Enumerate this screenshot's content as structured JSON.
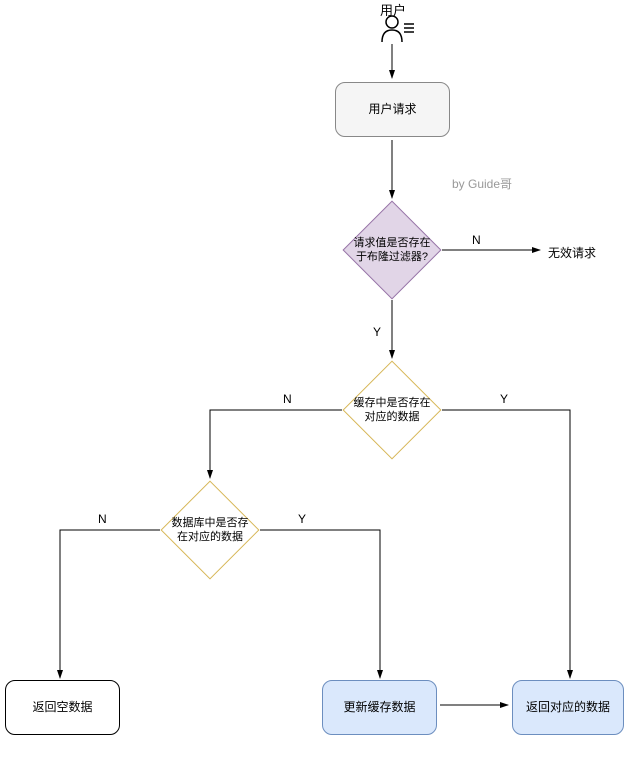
{
  "actor": {
    "label": "用户"
  },
  "nodes": {
    "request": "用户请求",
    "bloom_filter": "请求值是否存在于布隆过滤器?",
    "invalid": "无效请求",
    "cache_check": "缓存中是否存在对应的数据",
    "db_check": "数据库中是否存在对应的数据",
    "return_empty": "返回空数据",
    "update_cache": "更新缓存数据",
    "return_data": "返回对应的数据"
  },
  "labels": {
    "yes": "Y",
    "no": "N"
  },
  "credit": "by Guide哥",
  "chart_data": {
    "type": "flowchart",
    "title": "",
    "nodes": [
      {
        "id": "user",
        "type": "actor",
        "label": "用户"
      },
      {
        "id": "request",
        "type": "process",
        "label": "用户请求"
      },
      {
        "id": "bloom",
        "type": "decision",
        "label": "请求值是否存在于布隆过滤器?"
      },
      {
        "id": "invalid",
        "type": "terminal",
        "label": "无效请求"
      },
      {
        "id": "cache",
        "type": "decision",
        "label": "缓存中是否存在对应的数据"
      },
      {
        "id": "db",
        "type": "decision",
        "label": "数据库中是否存在对应的数据"
      },
      {
        "id": "empty",
        "type": "process",
        "label": "返回空数据"
      },
      {
        "id": "update",
        "type": "process",
        "label": "更新缓存数据"
      },
      {
        "id": "return",
        "type": "process",
        "label": "返回对应的数据"
      }
    ],
    "edges": [
      {
        "from": "user",
        "to": "request",
        "label": ""
      },
      {
        "from": "request",
        "to": "bloom",
        "label": ""
      },
      {
        "from": "bloom",
        "to": "invalid",
        "label": "N"
      },
      {
        "from": "bloom",
        "to": "cache",
        "label": "Y"
      },
      {
        "from": "cache",
        "to": "db",
        "label": "N"
      },
      {
        "from": "cache",
        "to": "return",
        "label": "Y"
      },
      {
        "from": "db",
        "to": "empty",
        "label": "N"
      },
      {
        "from": "db",
        "to": "update",
        "label": "Y"
      },
      {
        "from": "update",
        "to": "return",
        "label": ""
      }
    ]
  }
}
